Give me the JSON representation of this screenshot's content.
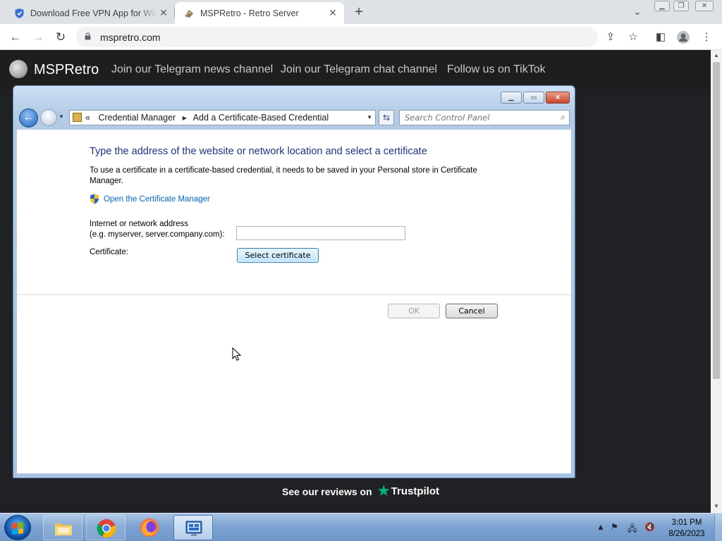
{
  "browser": {
    "tabs": [
      {
        "title": "Download Free VPN App for Win",
        "close": "✕"
      },
      {
        "title": "MSPRetro - Retro Server",
        "close": "✕"
      }
    ],
    "new_tab": "+",
    "url": "mspretro.com"
  },
  "site": {
    "logo": "MSPRetro",
    "nav": [
      "Join our Telegram news channel",
      "Join our Telegram chat channel",
      "Follow us on TikTok"
    ],
    "reviews_text": "See our reviews on",
    "trustpilot": "Trustpilot"
  },
  "window": {
    "breadcrumb": {
      "root_chevron": "«",
      "items": [
        "Credential Manager",
        "Add a Certificate-Based Credential"
      ]
    },
    "search_placeholder": "Search Control Panel",
    "heading": "Type the address of the website or network location and select a certificate",
    "description": "To use a certificate in a certificate-based credential, it needs to be saved in your Personal store in Certificate Manager.",
    "cert_manager_link": "Open the Certificate Manager",
    "address_label_1": "Internet or network address",
    "address_label_2": "(e.g. myserver, server.company.com):",
    "address_value": "",
    "certificate_label": "Certificate:",
    "select_certificate": "Select certificate",
    "ok": "OK",
    "cancel": "Cancel"
  },
  "taskbar": {
    "time": "3:01 PM",
    "date": "8/26/2023"
  },
  "colors": {
    "link": "#0066cc",
    "heading": "#1e3287",
    "trustpilot_green": "#00b67a"
  }
}
